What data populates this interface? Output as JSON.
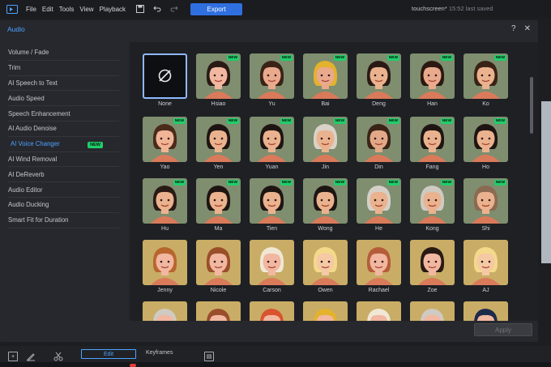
{
  "app": {
    "menu": [
      "File",
      "Edit",
      "Tools",
      "View",
      "Playback"
    ],
    "export_label": "Export",
    "project_name": "touchscreen*",
    "saved_status": "15:52 last saved"
  },
  "panel": {
    "title": "Audio",
    "help_icon": "?",
    "close_icon": "✕",
    "sidebar": [
      {
        "label": "Volume / Fade",
        "active": false
      },
      {
        "label": "Trim",
        "active": false
      },
      {
        "label": "AI Speech to Text",
        "active": false
      },
      {
        "label": "Audio Speed",
        "active": false
      },
      {
        "label": "Speech Enhancement",
        "active": false
      },
      {
        "label": "AI Audio Denoise",
        "active": false
      },
      {
        "label": "AI Voice Changer",
        "active": true,
        "badge": "NEW"
      },
      {
        "label": "AI Wind Removal",
        "active": false
      },
      {
        "label": "AI DeReverb",
        "active": false
      },
      {
        "label": "Audio Editor",
        "active": false
      },
      {
        "label": "Audio Ducking",
        "active": false
      },
      {
        "label": "Smart Fit for Duration",
        "active": false
      }
    ],
    "voices": [
      {
        "name": "None",
        "new": false,
        "bg": "#0e0f12",
        "skin": "",
        "hair": "",
        "none": true
      },
      {
        "name": "Hsiao",
        "new": true,
        "bg": "#7e8e6f",
        "skin": "#f1b7a0",
        "hair": "#2a1a14"
      },
      {
        "name": "Yu",
        "new": true,
        "bg": "#7e8e6f",
        "skin": "#e9a98d",
        "hair": "#3a2216"
      },
      {
        "name": "Bai",
        "new": true,
        "bg": "#7e8e6f",
        "skin": "#e9a98d",
        "hair": "#e4b22c"
      },
      {
        "name": "Deng",
        "new": true,
        "bg": "#7e8e6f",
        "skin": "#eab28e",
        "hair": "#2a1a14"
      },
      {
        "name": "Han",
        "new": true,
        "bg": "#7e8e6f",
        "skin": "#e9a98d",
        "hair": "#2b1810"
      },
      {
        "name": "Ko",
        "new": true,
        "bg": "#7e8e6f",
        "skin": "#eab28e",
        "hair": "#3a2216"
      },
      {
        "name": "Yao",
        "new": true,
        "bg": "#7e8e6f",
        "skin": "#f0b596",
        "hair": "#4a2a1a"
      },
      {
        "name": "Yen",
        "new": true,
        "bg": "#7e8e6f",
        "skin": "#eab28e",
        "hair": "#1e1512"
      },
      {
        "name": "Yuan",
        "new": true,
        "bg": "#7e8e6f",
        "skin": "#eab28e",
        "hair": "#1e1512"
      },
      {
        "name": "Jin",
        "new": true,
        "bg": "#7e8e6f",
        "skin": "#eab28e",
        "hair": "#d9d2c8"
      },
      {
        "name": "Din",
        "new": true,
        "bg": "#7e8e6f",
        "skin": "#e2a887",
        "hair": "#3a2416"
      },
      {
        "name": "Fang",
        "new": true,
        "bg": "#7e8e6f",
        "skin": "#eab28e",
        "hair": "#1e1512"
      },
      {
        "name": "Ho",
        "new": true,
        "bg": "#7e8e6f",
        "skin": "#eab28e",
        "hair": "#1e1512"
      },
      {
        "name": "Hu",
        "new": true,
        "bg": "#7e8e6f",
        "skin": "#eab28e",
        "hair": "#2a1a14"
      },
      {
        "name": "Ma",
        "new": true,
        "bg": "#7e8e6f",
        "skin": "#eab28e",
        "hair": "#1e1512"
      },
      {
        "name": "Tien",
        "new": true,
        "bg": "#7e8e6f",
        "skin": "#eab28e",
        "hair": "#1e1512"
      },
      {
        "name": "Wong",
        "new": true,
        "bg": "#7e8e6f",
        "skin": "#eab28e",
        "hair": "#1e1512"
      },
      {
        "name": "He",
        "new": true,
        "bg": "#7e8e6f",
        "skin": "#eab28e",
        "hair": "#d4d0c8"
      },
      {
        "name": "Kong",
        "new": true,
        "bg": "#7e8e6f",
        "skin": "#eab28e",
        "hair": "#cfcac2"
      },
      {
        "name": "Shi",
        "new": true,
        "bg": "#7e8e6f",
        "skin": "#eab28e",
        "hair": "#8a6a52"
      },
      {
        "name": "Jenny",
        "new": false,
        "bg": "#c9ad66",
        "skin": "#f1b7a0",
        "hair": "#b8652e"
      },
      {
        "name": "Nicole",
        "new": false,
        "bg": "#c9ad66",
        "skin": "#f1b7a0",
        "hair": "#9a4e2a"
      },
      {
        "name": "Carson",
        "new": false,
        "bg": "#c9ad66",
        "skin": "#f1b7a0",
        "hair": "#f0e8d4"
      },
      {
        "name": "Owen",
        "new": false,
        "bg": "#c9ad66",
        "skin": "#f4c9a4",
        "hair": "#f4d98a"
      },
      {
        "name": "Rachael",
        "new": false,
        "bg": "#c9ad66",
        "skin": "#f1b7a0",
        "hair": "#b55d3a"
      },
      {
        "name": "Zoe",
        "new": false,
        "bg": "#c9ad66",
        "skin": "#f1b7a0",
        "hair": "#2a1a14"
      },
      {
        "name": "AJ",
        "new": false,
        "bg": "#c9ad66",
        "skin": "#f4c9a4",
        "hair": "#f4d98a"
      },
      {
        "name": "",
        "new": false,
        "bg": "#c9ad66",
        "skin": "#f1b7a0",
        "hair": "#cfcac2"
      },
      {
        "name": "",
        "new": false,
        "bg": "#c9ad66",
        "skin": "#f1b7a0",
        "hair": "#9a4e2a"
      },
      {
        "name": "",
        "new": false,
        "bg": "#c9ad66",
        "skin": "#f1b7a0",
        "hair": "#d9542e"
      },
      {
        "name": "",
        "new": false,
        "bg": "#c9ad66",
        "skin": "#f1b7a0",
        "hair": "#e4b22c"
      },
      {
        "name": "",
        "new": false,
        "bg": "#c9ad66",
        "skin": "#f1b7a0",
        "hair": "#f0e8d4"
      },
      {
        "name": "",
        "new": false,
        "bg": "#c9ad66",
        "skin": "#f1b7a0",
        "hair": "#cfcac2"
      },
      {
        "name": "",
        "new": false,
        "bg": "#c9ad66",
        "skin": "#f1b7a0",
        "hair": "#1e2a4a"
      }
    ],
    "apply_label": "Apply"
  },
  "bottom": {
    "edit_label": "Edit",
    "keyframes_label": "Keyframes"
  }
}
